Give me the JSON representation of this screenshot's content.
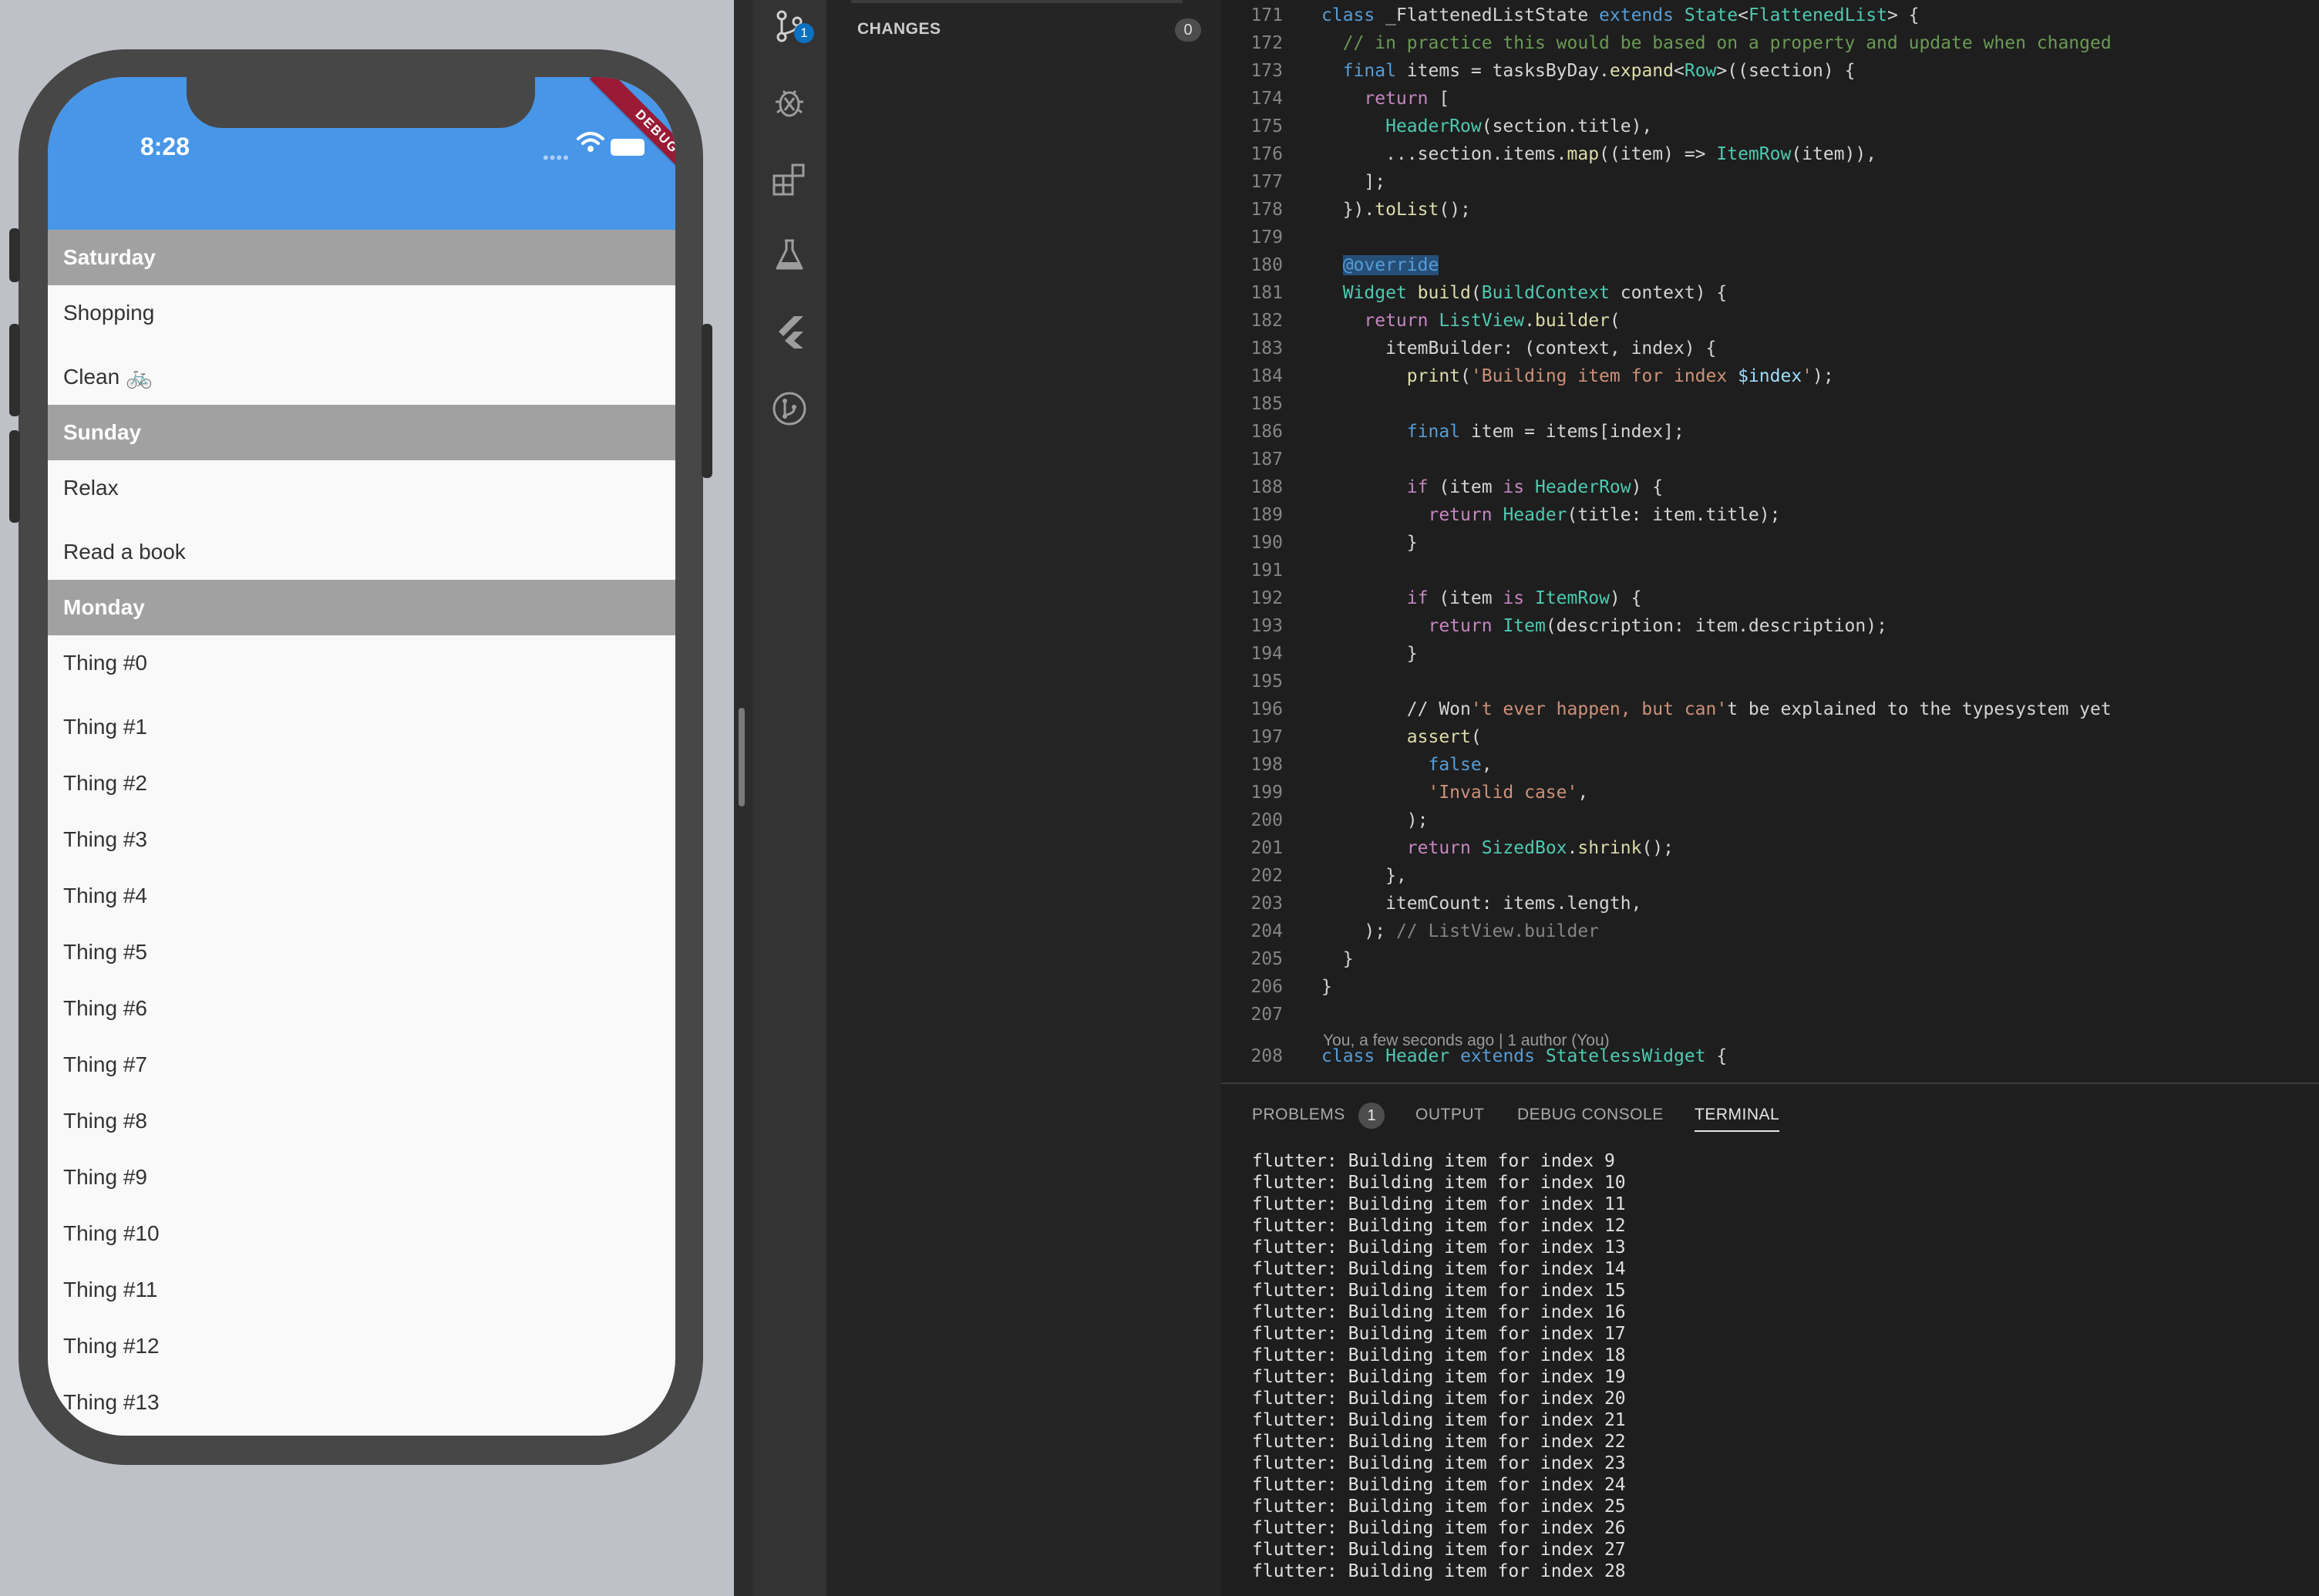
{
  "simulator": {
    "status_time": "8:28",
    "debug_ribbon": "DEBUG",
    "sections": [
      {
        "title": "Saturday",
        "items": [
          "Shopping",
          "Clean 🚲"
        ]
      },
      {
        "title": "Sunday",
        "items": [
          "Relax",
          "Read a book"
        ]
      },
      {
        "title": "Monday",
        "items": [
          "Thing #0",
          "Thing #1",
          "Thing #2",
          "Thing #3",
          "Thing #4",
          "Thing #5",
          "Thing #6",
          "Thing #7",
          "Thing #8",
          "Thing #9",
          "Thing #10",
          "Thing #11",
          "Thing #12",
          "Thing #13"
        ]
      }
    ],
    "colors": {
      "app_bar": "#4796e8",
      "header_row": "#a1a1a1",
      "ribbon": "#9b1a35"
    }
  },
  "activity_bar": {
    "icons": [
      "source-control-icon",
      "debug-icon",
      "extensions-icon",
      "testing-flask-icon",
      "flutter-icon",
      "gitlens-icon"
    ],
    "scm_badge": "1"
  },
  "sidebar": {
    "changes_label": "CHANGES",
    "changes_count": "0"
  },
  "editor": {
    "blame": "You, a few seconds ago | 1 author (You)",
    "lines": [
      {
        "n": "171",
        "code": "class _FlattenedListState extends State<FlattenedList> {"
      },
      {
        "n": "172",
        "code": "  // in practice this would be based on a property and update when changed"
      },
      {
        "n": "173",
        "code": "  final items = tasksByDay.expand<Row>((section) {"
      },
      {
        "n": "174",
        "code": "    return ["
      },
      {
        "n": "175",
        "code": "      HeaderRow(section.title),"
      },
      {
        "n": "176",
        "code": "      ...section.items.map((item) => ItemRow(item)),"
      },
      {
        "n": "177",
        "code": "    ];"
      },
      {
        "n": "178",
        "code": "  }).toList();"
      },
      {
        "n": "179",
        "code": ""
      },
      {
        "n": "180",
        "code": "  @override"
      },
      {
        "n": "181",
        "code": "  Widget build(BuildContext context) {"
      },
      {
        "n": "182",
        "code": "    return ListView.builder("
      },
      {
        "n": "183",
        "code": "      itemBuilder: (context, index) {"
      },
      {
        "n": "184",
        "code": "        print('Building item for index $index');"
      },
      {
        "n": "185",
        "code": ""
      },
      {
        "n": "186",
        "code": "        final item = items[index];"
      },
      {
        "n": "187",
        "code": ""
      },
      {
        "n": "188",
        "code": "        if (item is HeaderRow) {"
      },
      {
        "n": "189",
        "code": "          return Header(title: item.title);"
      },
      {
        "n": "190",
        "code": "        }"
      },
      {
        "n": "191",
        "code": ""
      },
      {
        "n": "192",
        "code": "        if (item is ItemRow) {"
      },
      {
        "n": "193",
        "code": "          return Item(description: item.description);"
      },
      {
        "n": "194",
        "code": "        }"
      },
      {
        "n": "195",
        "code": ""
      },
      {
        "n": "196",
        "code": "        // Won't ever happen, but can't be explained to the typesystem yet"
      },
      {
        "n": "197",
        "code": "        assert("
      },
      {
        "n": "198",
        "code": "          false,"
      },
      {
        "n": "199",
        "code": "          'Invalid case',"
      },
      {
        "n": "200",
        "code": "        );"
      },
      {
        "n": "201",
        "code": "        return SizedBox.shrink();"
      },
      {
        "n": "202",
        "code": "      },"
      },
      {
        "n": "203",
        "code": "      itemCount: items.length,"
      },
      {
        "n": "204",
        "code": "    ); // ListView.builder"
      },
      {
        "n": "205",
        "code": "  }"
      },
      {
        "n": "206",
        "code": "}"
      },
      {
        "n": "207",
        "code": ""
      },
      {
        "n": "208",
        "code": "class Header extends StatelessWidget {"
      }
    ]
  },
  "panel": {
    "tabs": [
      {
        "label": "PROBLEMS",
        "badge": "1"
      },
      {
        "label": "OUTPUT"
      },
      {
        "label": "DEBUG CONSOLE"
      },
      {
        "label": "TERMINAL",
        "active": true
      }
    ],
    "terminal_lines": [
      "flutter: Building item for index 9",
      "flutter: Building item for index 10",
      "flutter: Building item for index 11",
      "flutter: Building item for index 12",
      "flutter: Building item for index 13",
      "flutter: Building item for index 14",
      "flutter: Building item for index 15",
      "flutter: Building item for index 16",
      "flutter: Building item for index 17",
      "flutter: Building item for index 18",
      "flutter: Building item for index 19",
      "flutter: Building item for index 20",
      "flutter: Building item for index 21",
      "flutter: Building item for index 22",
      "flutter: Building item for index 23",
      "flutter: Building item for index 24",
      "flutter: Building item for index 25",
      "flutter: Building item for index 26",
      "flutter: Building item for index 27",
      "flutter: Building item for index 28"
    ]
  }
}
